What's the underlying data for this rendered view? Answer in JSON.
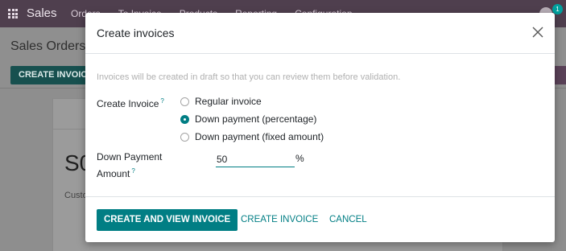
{
  "app": {
    "name": "Sales",
    "menu": [
      "Orders",
      "To Invoice",
      "Products",
      "Reporting",
      "Configuration"
    ],
    "notification_count": "1"
  },
  "control_panel": {
    "breadcrumb": "Sales Orders",
    "create_button": "CREATE INVOICE"
  },
  "sheet": {
    "record_name": "S0",
    "customer_label": "Custo"
  },
  "dialog": {
    "title": "Create invoices",
    "info": "Invoices will be created in draft so that you can review them before validation.",
    "create_invoice_label": "Create Invoice",
    "help_mark": "?",
    "options": [
      {
        "label": "Regular invoice",
        "checked": false
      },
      {
        "label": "Down payment (percentage)",
        "checked": true
      },
      {
        "label": "Down payment (fixed amount)",
        "checked": false
      }
    ],
    "down_payment_label_line1": "Down Payment",
    "down_payment_label_line2": "Amount",
    "amount_value": "50",
    "amount_unit": "%",
    "buttons": {
      "create_and_view": "CREATE AND VIEW INVOICE",
      "create": "CREATE INVOICE",
      "cancel": "CANCEL"
    }
  },
  "colors": {
    "primary": "#017e84",
    "topbar": "#4f3f4e"
  }
}
